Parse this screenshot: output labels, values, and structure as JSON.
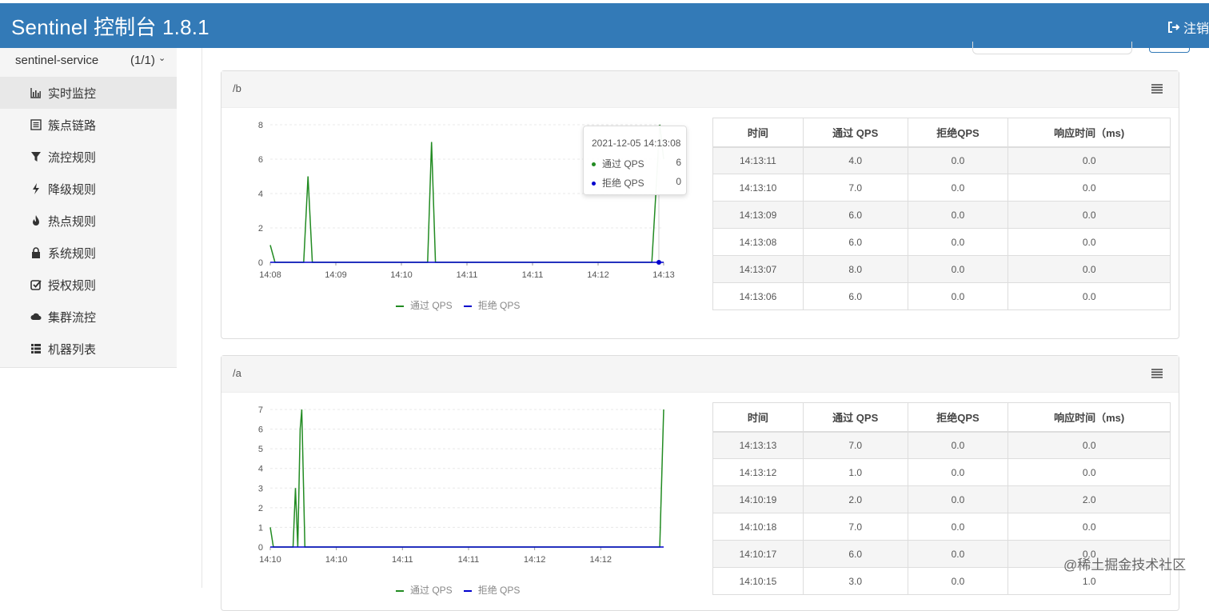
{
  "header": {
    "title": "Sentinel 控制台 1.8.1",
    "logout_label": "注销",
    "color": "#337ab7"
  },
  "sidebar": {
    "app_name": "sentinel-service",
    "app_count": "(1/1)",
    "items": [
      {
        "label": "实时监控",
        "icon": "bar-chart-icon",
        "active": true
      },
      {
        "label": "簇点链路",
        "icon": "list-icon"
      },
      {
        "label": "流控规则",
        "icon": "filter-icon"
      },
      {
        "label": "降级规则",
        "icon": "flash-icon"
      },
      {
        "label": "热点规则",
        "icon": "fire-icon"
      },
      {
        "label": "系统规则",
        "icon": "lock-icon"
      },
      {
        "label": "授权规则",
        "icon": "check-icon"
      },
      {
        "label": "集群流控",
        "icon": "cloud-icon"
      },
      {
        "label": "机器列表",
        "icon": "th-list-icon"
      }
    ]
  },
  "table_headers": [
    "时间",
    "通过 QPS",
    "拒绝QPS",
    "响应时间（ms)"
  ],
  "legend": {
    "pass": "通过 QPS",
    "block": "拒绝 QPS",
    "pass_color": "#228B22",
    "block_color": "#0000CD"
  },
  "panels": [
    {
      "title": "/b",
      "rows": [
        [
          "14:13:11",
          "4.0",
          "0.0",
          "0.0"
        ],
        [
          "14:13:10",
          "7.0",
          "0.0",
          "0.0"
        ],
        [
          "14:13:09",
          "6.0",
          "0.0",
          "0.0"
        ],
        [
          "14:13:08",
          "6.0",
          "0.0",
          "0.0"
        ],
        [
          "14:13:07",
          "8.0",
          "0.0",
          "0.0"
        ],
        [
          "14:13:06",
          "6.0",
          "0.0",
          "0.0"
        ]
      ],
      "tooltip": {
        "time": "2021-12-05 14:13:08",
        "pass_label": "通过 QPS",
        "pass_value": "6",
        "block_label": "拒绝 QPS",
        "block_value": "0"
      }
    },
    {
      "title": "/a",
      "rows": [
        [
          "14:13:13",
          "7.0",
          "0.0",
          "0.0"
        ],
        [
          "14:13:12",
          "1.0",
          "0.0",
          "0.0"
        ],
        [
          "14:10:19",
          "2.0",
          "0.0",
          "2.0"
        ],
        [
          "14:10:18",
          "7.0",
          "0.0",
          "0.0"
        ],
        [
          "14:10:17",
          "6.0",
          "0.0",
          "0.0"
        ],
        [
          "14:10:15",
          "3.0",
          "0.0",
          "1.0"
        ]
      ]
    }
  ],
  "chart_data": [
    {
      "type": "line",
      "x_ticks": [
        "14:08",
        "14:09",
        "14:10",
        "14:11",
        "14:11",
        "14:12",
        "14:13"
      ],
      "y_ticks": [
        "0",
        "2",
        "4",
        "6",
        "8"
      ],
      "ylim": [
        0,
        8
      ],
      "series": [
        {
          "name": "通过 QPS",
          "color": "#228B22",
          "points": [
            [
              0,
              1
            ],
            [
              0.012,
              0
            ],
            [
              0.085,
              0
            ],
            [
              0.096,
              5
            ],
            [
              0.107,
              0
            ],
            [
              0.4,
              0
            ],
            [
              0.41,
              7
            ],
            [
              0.42,
              0
            ],
            [
              0.97,
              0
            ],
            [
              0.98,
              4
            ],
            [
              0.99,
              8
            ],
            [
              1.0,
              6
            ]
          ]
        },
        {
          "name": "拒绝 QPS",
          "color": "#0000CD",
          "points": [
            [
              0,
              0
            ],
            [
              1.0,
              0
            ]
          ]
        }
      ]
    },
    {
      "type": "line",
      "x_ticks": [
        "14:10",
        "14:10",
        "14:11",
        "14:11",
        "14:12",
        "14:12"
      ],
      "y_ticks": [
        "0",
        "1",
        "2",
        "3",
        "4",
        "5",
        "6",
        "7"
      ],
      "ylim": [
        0,
        7
      ],
      "series": [
        {
          "name": "通过 QPS",
          "color": "#228B22",
          "points": [
            [
              0,
              1
            ],
            [
              0.008,
              0
            ],
            [
              0.058,
              0
            ],
            [
              0.064,
              3
            ],
            [
              0.07,
              0
            ],
            [
              0.076,
              6
            ],
            [
              0.08,
              7
            ],
            [
              0.088,
              0
            ],
            [
              0.99,
              0
            ],
            [
              1.0,
              7
            ]
          ]
        },
        {
          "name": "拒绝 QPS",
          "color": "#0000CD",
          "points": [
            [
              0,
              0
            ],
            [
              1.0,
              0
            ]
          ]
        }
      ]
    }
  ],
  "watermark": "@稀土掘金技术社区"
}
